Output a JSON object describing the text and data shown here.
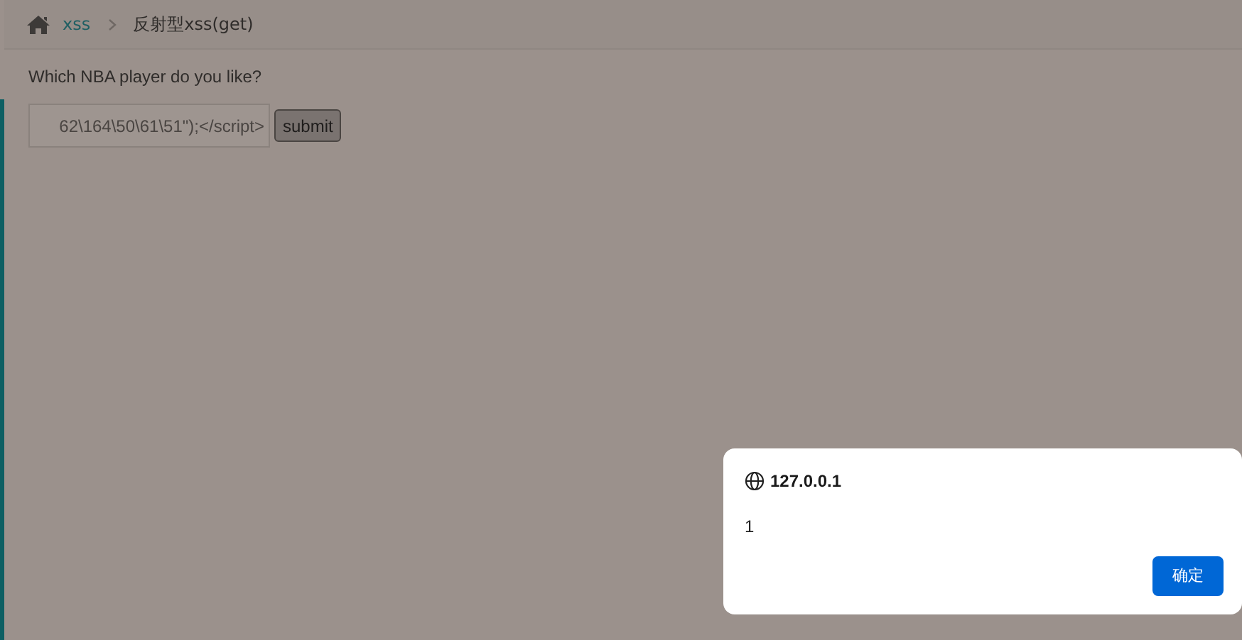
{
  "breadcrumb": [
    {
      "label": "xss",
      "kind": "link"
    },
    {
      "label": "反射型xss(get)",
      "kind": "current"
    }
  ],
  "form": {
    "question": "Which NBA player do you like?",
    "input_value": "62\\164\\50\\61\\51\");</script>",
    "button": "submit"
  },
  "alert": {
    "origin": "127.0.0.1",
    "message": "1",
    "button": "确定"
  }
}
